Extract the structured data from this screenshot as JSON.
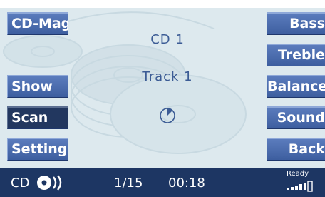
{
  "left_buttons": [
    {
      "label": "CD-Mag"
    },
    {
      "label": "Show"
    },
    {
      "label": "Scan"
    },
    {
      "label": "Setting"
    }
  ],
  "right_buttons": [
    {
      "label": "Bass"
    },
    {
      "label": "Treble"
    },
    {
      "label": "Balance"
    },
    {
      "label": "Sound"
    },
    {
      "label": "Back"
    }
  ],
  "center": {
    "cd_label": "CD 1",
    "track_label": "Track 1",
    "timer_icon": "clock-icon"
  },
  "status": {
    "source_label": "CD",
    "source_icon": "disc-icon",
    "track_count": "1/15",
    "time": "00:18",
    "ready_label": "Ready",
    "signal_icon": "signal-icon"
  },
  "active_button": "Scan",
  "colors": {
    "button": "#4a6aab",
    "button_active": "#22375f",
    "text_center": "#3c5c95",
    "statusbar": "#1d3663",
    "background": "#dde9ee"
  }
}
